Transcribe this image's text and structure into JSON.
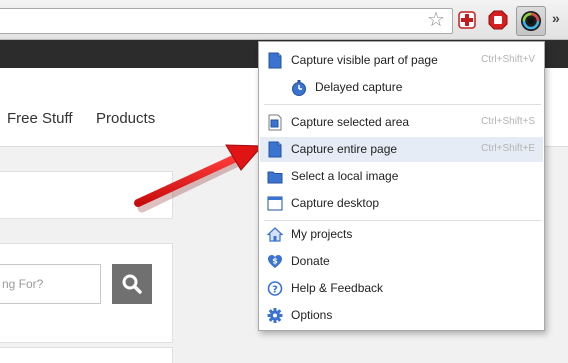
{
  "nav": {
    "items": [
      "Free Stuff",
      "Products"
    ]
  },
  "search": {
    "placeholder": "ng For?"
  },
  "menu": {
    "items": [
      {
        "label": "Capture visible part of page",
        "shortcut": "Ctrl+Shift+V",
        "icon": "page-icon"
      },
      {
        "label": "Delayed capture",
        "shortcut": "",
        "icon": "timer-icon"
      },
      {
        "label": "Capture selected area",
        "shortcut": "Ctrl+Shift+S",
        "icon": "selection-icon"
      },
      {
        "label": "Capture entire page",
        "shortcut": "Ctrl+Shift+E",
        "icon": "page-icon"
      },
      {
        "label": "Select a local image",
        "shortcut": "",
        "icon": "folder-icon"
      },
      {
        "label": "Capture desktop",
        "shortcut": "",
        "icon": "window-icon"
      },
      {
        "label": "My projects",
        "shortcut": "",
        "icon": "home-icon"
      },
      {
        "label": "Donate",
        "shortcut": "",
        "icon": "heart-dollar-icon"
      },
      {
        "label": "Help & Feedback",
        "shortcut": "",
        "icon": "help-icon"
      },
      {
        "label": "Options",
        "shortcut": "",
        "icon": "gear-icon"
      }
    ]
  },
  "colors": {
    "accent": "#3b73d1",
    "arrow": "#e01414",
    "highlight": "#e6ecf5"
  }
}
